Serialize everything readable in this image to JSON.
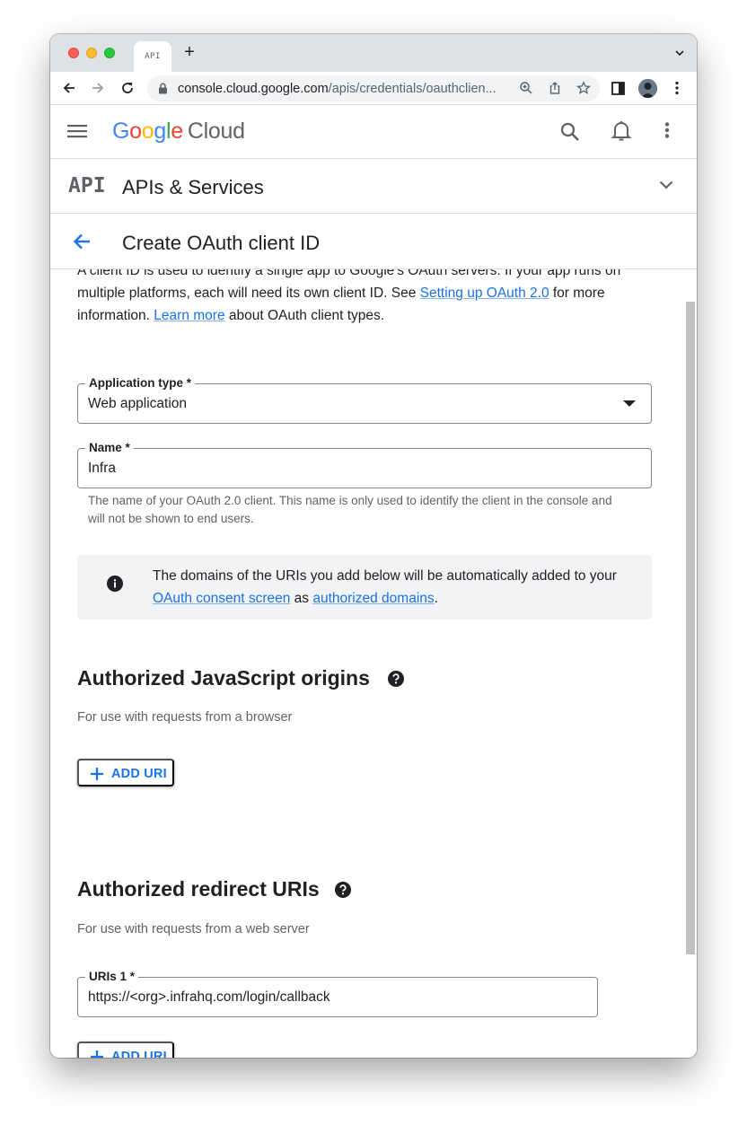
{
  "browser": {
    "tab_favicon_text": "API",
    "new_tab_label": "+",
    "url_host": "console.cloud.google.com",
    "url_path": "/apis/credentials/oauthclien..."
  },
  "header": {
    "logo_google": [
      "G",
      "o",
      "o",
      "g",
      "l",
      "e"
    ],
    "logo_colors": [
      "#4285f4",
      "#ea4335",
      "#fbbc04",
      "#4285f4",
      "#34a853",
      "#ea4335"
    ],
    "logo_cloud": "Cloud"
  },
  "api_bar": {
    "logo_text": "API",
    "title": "APIs & Services"
  },
  "page": {
    "title": "Create OAuth client ID"
  },
  "intro": {
    "text_1": "A client ID is used to identify a single app to Google's OAuth servers. If your app runs on multiple platforms, each will need its own client ID. See ",
    "link_1": "Setting up OAuth 2.0",
    "text_2": " for more information. ",
    "link_2": "Learn more",
    "text_3": " about OAuth client types."
  },
  "application_type": {
    "label": "Application type *",
    "value": "Web application"
  },
  "name_field": {
    "label": "Name *",
    "value": "Infra",
    "hint": "The name of your OAuth 2.0 client. This name is only used to identify the client in the console and will not be shown to end users."
  },
  "info_box": {
    "text_1": "The domains of the URIs you add below will be automatically added to your ",
    "link_1": "OAuth consent screen",
    "text_2": " as ",
    "link_2": "authorized domains",
    "text_3": "."
  },
  "js_origins": {
    "title": "Authorized JavaScript origins",
    "subtitle": "For use with requests from a browser",
    "add_label": "ADD URI"
  },
  "redirect_uris": {
    "title": "Authorized redirect URIs",
    "subtitle": "For use with requests from a web server",
    "uri_label": "URIs 1 *",
    "uri_value": "https://<org>.infrahq.com/login/callback",
    "add_label": "ADD URI"
  },
  "colors": {
    "accent": "#1a73e8",
    "info_bg": "#f1f3f4"
  }
}
